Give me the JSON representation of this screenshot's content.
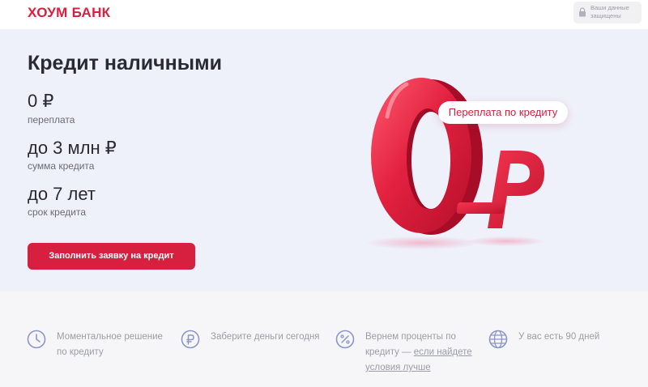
{
  "header": {
    "logo": "ХОУМ БАНК",
    "secure_badge": "Ваши данные защищены",
    "secure_icon": "lock-icon"
  },
  "hero": {
    "title": "Кредит наличными",
    "stats": [
      {
        "value": "0 ₽",
        "label": "переплата"
      },
      {
        "value": "до 3 млн ₽",
        "label": "сумма кредита"
      },
      {
        "value": "до 7 лет",
        "label": "срок кредита"
      }
    ],
    "cta_label": "Заполнить заявку на кредит",
    "promo_pill": "Переплата по кредиту",
    "promo_big_digit": "0",
    "promo_currency": "₽"
  },
  "features": [
    {
      "icon": "clock-icon",
      "text": "Моментальное решение по кредиту"
    },
    {
      "icon": "ruble-coin-icon",
      "text": "Заберите деньги сегодня"
    },
    {
      "icon": "percent-icon",
      "text_before": "Вернем проценты по кредиту — ",
      "link": "если найдете условия лучше"
    },
    {
      "icon": "globe-icon",
      "text": "У вас есть 90 дней"
    }
  ],
  "colors": {
    "brand": "#d71f3f",
    "hero_bg": "#eef0fa",
    "page_bg": "#f6f6f8"
  }
}
